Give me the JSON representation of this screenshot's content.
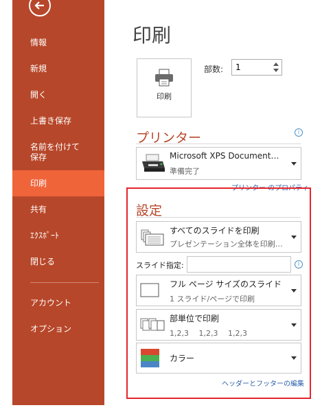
{
  "sidebar": {
    "back_icon": "back-arrow-icon",
    "items": [
      {
        "label": "情報"
      },
      {
        "label": "新規"
      },
      {
        "label": "開く"
      },
      {
        "label": "上書き保存"
      },
      {
        "label": "名前を付けて\n保存"
      },
      {
        "label": "印刷",
        "active": true
      },
      {
        "label": "共有"
      },
      {
        "label": "ｴｸｽﾎﾟｰﾄ"
      },
      {
        "label": "閉じる"
      },
      {
        "label": "アカウント"
      },
      {
        "label": "オプション"
      }
    ],
    "colors": {
      "background": "#b7472a",
      "active": "#f0643a"
    }
  },
  "main": {
    "title": "印刷",
    "print_button": {
      "label": "印刷",
      "icon": "printer-icon"
    },
    "copies": {
      "label": "部数:",
      "value": "1"
    },
    "printer": {
      "section_title": "プリンター",
      "name": "Microsoft XPS Document…",
      "status": "準備完了",
      "properties_link": "プリンター のプロパティ"
    },
    "settings": {
      "section_title": "設定",
      "print_range": {
        "main": "すべてのスライドを印刷",
        "sub": "プレゼンテーション全体を印刷…"
      },
      "slides_label": "スライド指定:",
      "slides_value": "",
      "layout": {
        "main": "フル ページ サイズのスライド",
        "sub": "1 スライド/ページで印刷"
      },
      "collate": {
        "main": "部単位で印刷",
        "sub": "1,2,3　 1,2,3　 1,2,3"
      },
      "color": {
        "main": "カラー"
      },
      "header_footer_link": "ヘッダーとフッターの編集"
    }
  },
  "accent_color": "#b7472a",
  "highlight_color": "#e4232b"
}
